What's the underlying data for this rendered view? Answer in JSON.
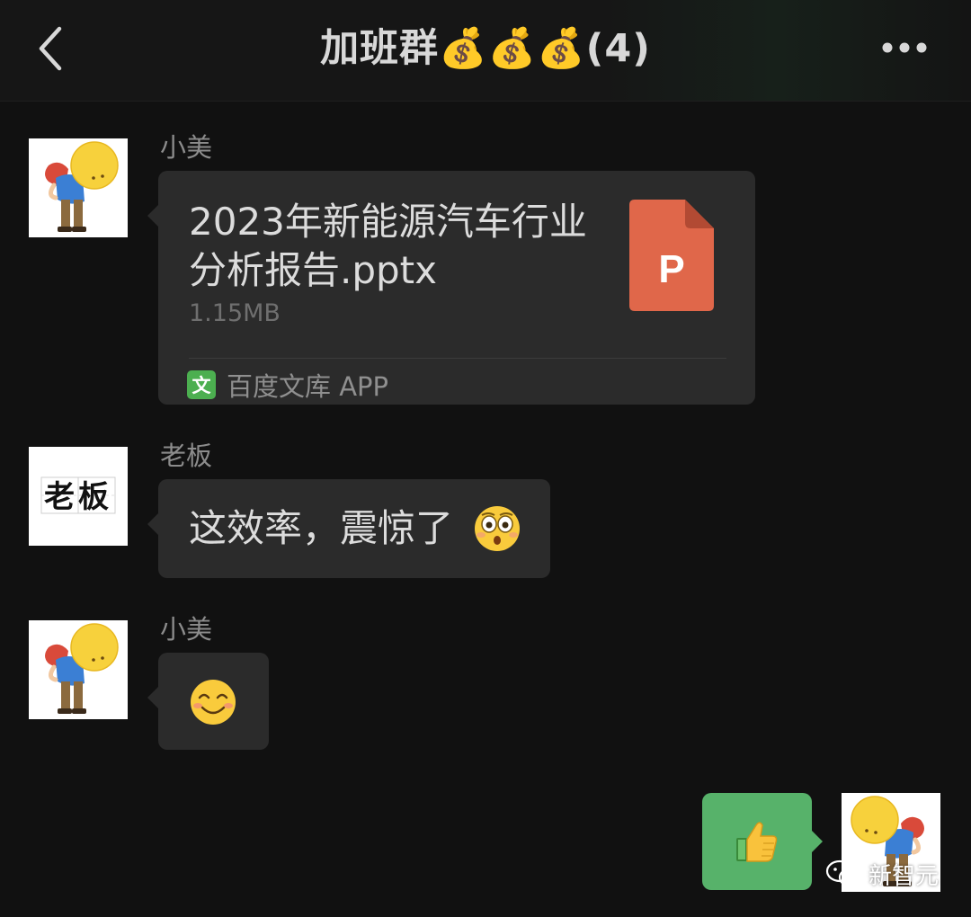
{
  "header": {
    "title": "加班群💰💰💰(4)",
    "back_icon": "chevron-left-icon",
    "more_icon": "more-dots-icon"
  },
  "messages": [
    {
      "sender": "小美",
      "type": "file",
      "file_name": "2023年新能源汽车行业分析报告.pptx",
      "file_size": "1.15MB",
      "file_icon_letter": "P",
      "source_icon_letter": "文",
      "source_label": "百度文库 APP"
    },
    {
      "sender": "老板",
      "avatar_text": "老板",
      "type": "text",
      "text": "这效率，震惊了",
      "emoji": "flushed-face-icon"
    },
    {
      "sender": "小美",
      "type": "emoji",
      "emoji": "smiling-face-icon"
    },
    {
      "direction": "outgoing",
      "type": "emoji",
      "emoji": "thumbs-up-icon"
    }
  ],
  "watermark": {
    "text": "新智元",
    "icon": "wechat-icon"
  },
  "colors": {
    "background": "#111111",
    "bubble_incoming": "#2b2b2b",
    "bubble_outgoing": "#57b26a",
    "ppt_icon": "#e0674a",
    "source_icon": "#4caf50"
  }
}
